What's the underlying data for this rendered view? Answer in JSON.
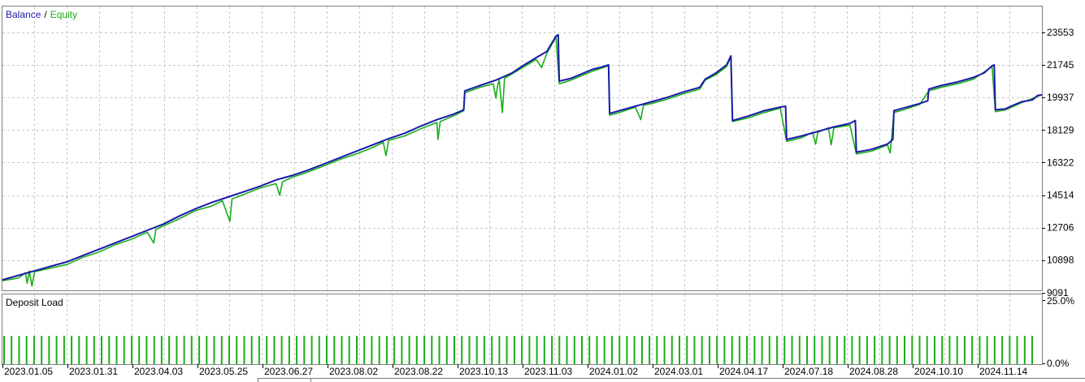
{
  "colors": {
    "balance": "#1a1aaa",
    "equity": "#1aad1a",
    "deposit_load": "#1aad1a",
    "grid": "#c8c8c8",
    "frame": "#808080",
    "text": "#000000"
  },
  "chart_data": [
    {
      "type": "line",
      "legend": {
        "items": [
          "Balance",
          "Equity"
        ],
        "separator": "/",
        "placement": "top-left"
      },
      "y_ticks": [
        "23553",
        "21745",
        "19937",
        "18129",
        "16322",
        "14514",
        "12706",
        "10898",
        "9091"
      ],
      "ylim": [
        9091,
        24457
      ],
      "xlim": [
        0,
        100
      ],
      "grid": true,
      "series": [
        {
          "name": "Balance",
          "points": [
            [
              0,
              9800
            ],
            [
              3,
              10050
            ],
            [
              6,
              10300
            ],
            [
              9,
              10550
            ],
            [
              12,
              10800
            ],
            [
              15,
              11150
            ],
            [
              18,
              11500
            ],
            [
              21,
              11850
            ],
            [
              24,
              12200
            ],
            [
              27,
              12550
            ],
            [
              30,
              12900
            ],
            [
              33,
              13350
            ],
            [
              36,
              13750
            ],
            [
              39,
              14100
            ],
            [
              42,
              14400
            ],
            [
              45,
              14700
            ],
            [
              48,
              15000
            ],
            [
              51,
              15350
            ],
            [
              54,
              15600
            ],
            [
              57,
              15900
            ],
            [
              60,
              16250
            ],
            [
              63,
              16600
            ],
            [
              66,
              16950
            ],
            [
              69,
              17300
            ],
            [
              72,
              17650
            ],
            [
              75,
              17950
            ],
            [
              78,
              18350
            ],
            [
              81,
              18700
            ],
            [
              84,
              19000
            ],
            [
              86,
              19250
            ],
            [
              86.2,
              20300
            ],
            [
              89,
              20600
            ],
            [
              92,
              20900
            ],
            [
              95,
              21300
            ],
            [
              97,
              21700
            ],
            [
              99.5,
              22150
            ],
            [
              101.5,
              22500
            ],
            [
              103.2,
              23350
            ],
            [
              103.6,
              23420
            ],
            [
              103.8,
              20850
            ],
            [
              106,
              21000
            ],
            [
              108,
              21250
            ],
            [
              110,
              21500
            ],
            [
              112,
              21650
            ],
            [
              113,
              21750
            ],
            [
              113.2,
              19050
            ],
            [
              115,
              19200
            ],
            [
              118,
              19450
            ],
            [
              121,
              19700
            ],
            [
              124,
              19950
            ],
            [
              127,
              20250
            ],
            [
              130,
              20500
            ],
            [
              131,
              20950
            ],
            [
              133,
              21300
            ],
            [
              135,
              21750
            ],
            [
              135.8,
              22250
            ],
            [
              136.1,
              18650
            ],
            [
              139,
              18900
            ],
            [
              142,
              19200
            ],
            [
              145,
              19400
            ],
            [
              146,
              19450
            ],
            [
              146.2,
              17600
            ],
            [
              149,
              17800
            ],
            [
              152,
              18050
            ],
            [
              155,
              18300
            ],
            [
              158,
              18500
            ],
            [
              159,
              18650
            ],
            [
              159.2,
              16900
            ],
            [
              162,
              17050
            ],
            [
              165,
              17350
            ],
            [
              166,
              17600
            ],
            [
              166.2,
              19200
            ],
            [
              168,
              19350
            ],
            [
              171,
              19600
            ],
            [
              172.5,
              19750
            ],
            [
              172.7,
              20400
            ],
            [
              175,
              20600
            ],
            [
              178,
              20800
            ],
            [
              181,
              21050
            ],
            [
              183,
              21300
            ],
            [
              184.5,
              21700
            ],
            [
              184.9,
              21750
            ],
            [
              185.1,
              19250
            ],
            [
              187,
              19300
            ],
            [
              188,
              19450
            ],
            [
              190,
              19700
            ],
            [
              192,
              19800
            ],
            [
              193,
              20050
            ],
            [
              194,
              20100
            ]
          ],
          "x_scale": 0.5154
        },
        {
          "name": "Equity",
          "points": [
            [
              0,
              9750
            ],
            [
              3,
              9900
            ],
            [
              4.3,
              10200
            ],
            [
              4.6,
              9600
            ],
            [
              5,
              10300
            ],
            [
              5.5,
              9450
            ],
            [
              6,
              10250
            ],
            [
              9,
              10450
            ],
            [
              12,
              10650
            ],
            [
              15,
              11050
            ],
            [
              18,
              11350
            ],
            [
              21,
              11750
            ],
            [
              24,
              12050
            ],
            [
              27,
              12450
            ],
            [
              28.2,
              11850
            ],
            [
              28.6,
              12600
            ],
            [
              30,
              12800
            ],
            [
              33,
              13200
            ],
            [
              36,
              13650
            ],
            [
              39,
              13900
            ],
            [
              41,
              14200
            ],
            [
              42.4,
              13050
            ],
            [
              42.8,
              14300
            ],
            [
              45,
              14550
            ],
            [
              48,
              14900
            ],
            [
              51,
              15150
            ],
            [
              51.7,
              14500
            ],
            [
              52.2,
              15250
            ],
            [
              54,
              15500
            ],
            [
              57,
              15800
            ],
            [
              60,
              16150
            ],
            [
              63,
              16500
            ],
            [
              66,
              16800
            ],
            [
              69,
              17150
            ],
            [
              71,
              17450
            ],
            [
              71.5,
              16700
            ],
            [
              72,
              17550
            ],
            [
              75,
              17800
            ],
            [
              78,
              18200
            ],
            [
              81,
              18550
            ],
            [
              81.2,
              17600
            ],
            [
              81.6,
              18600
            ],
            [
              84,
              18900
            ],
            [
              86,
              19200
            ],
            [
              86.2,
              20200
            ],
            [
              89,
              20500
            ],
            [
              91.5,
              20700
            ],
            [
              92,
              19900
            ],
            [
              92.3,
              20600
            ],
            [
              92.6,
              20900
            ],
            [
              93.2,
              19100
            ],
            [
              93.6,
              21000
            ],
            [
              95,
              21250
            ],
            [
              97,
              21600
            ],
            [
              99.5,
              22050
            ],
            [
              100.5,
              21600
            ],
            [
              101.5,
              22400
            ],
            [
              103.2,
              23300
            ],
            [
              103.8,
              20700
            ],
            [
              106,
              20900
            ],
            [
              108,
              21150
            ],
            [
              110,
              21400
            ],
            [
              113,
              21700
            ],
            [
              113.2,
              18950
            ],
            [
              115,
              19100
            ],
            [
              118,
              19400
            ],
            [
              119,
              18700
            ],
            [
              119.5,
              19500
            ],
            [
              121,
              19600
            ],
            [
              124,
              19850
            ],
            [
              127,
              20150
            ],
            [
              130,
              20400
            ],
            [
              131,
              20900
            ],
            [
              133,
              21200
            ],
            [
              135,
              21650
            ],
            [
              135.8,
              22200
            ],
            [
              136.1,
              18600
            ],
            [
              139,
              18800
            ],
            [
              142,
              19100
            ],
            [
              145,
              19350
            ],
            [
              146.2,
              17500
            ],
            [
              149,
              17700
            ],
            [
              151,
              18000
            ],
            [
              151.6,
              17350
            ],
            [
              152,
              18000
            ],
            [
              154,
              18250
            ],
            [
              154.5,
              17300
            ],
            [
              155,
              18250
            ],
            [
              158,
              18400
            ],
            [
              159.2,
              16800
            ],
            [
              162,
              16950
            ],
            [
              165,
              17300
            ],
            [
              165.5,
              16850
            ],
            [
              166.2,
              19100
            ],
            [
              168,
              19250
            ],
            [
              171,
              19550
            ],
            [
              172.7,
              20300
            ],
            [
              175,
              20500
            ],
            [
              178,
              20700
            ],
            [
              181,
              20950
            ],
            [
              184.5,
              21650
            ],
            [
              185.1,
              19150
            ],
            [
              187,
              19250
            ],
            [
              190,
              19650
            ],
            [
              193,
              20000
            ],
            [
              194,
              20100
            ]
          ],
          "x_scale": 0.5154
        }
      ]
    },
    {
      "type": "bar",
      "legend": {
        "items": [
          "Deposit Load"
        ],
        "placement": "top-left"
      },
      "y_ticks": [
        "25.0%",
        "0.0%"
      ],
      "ylim": [
        0,
        25
      ],
      "bar_value": 11,
      "bar_count": 138,
      "grid": true,
      "x_tick_labels": [
        "2023.01.05",
        "2023.01.31",
        "2023.04.03",
        "2023.05.25",
        "2023.06.27",
        "2023.08.02",
        "2023.08.22",
        "2023.10.13",
        "2023.11.03",
        "2024.01.02",
        "2024.03.01",
        "2024.04.17",
        "2024.07.18",
        "2024.08.28",
        "2024.10.10",
        "2024.11.14"
      ]
    }
  ]
}
